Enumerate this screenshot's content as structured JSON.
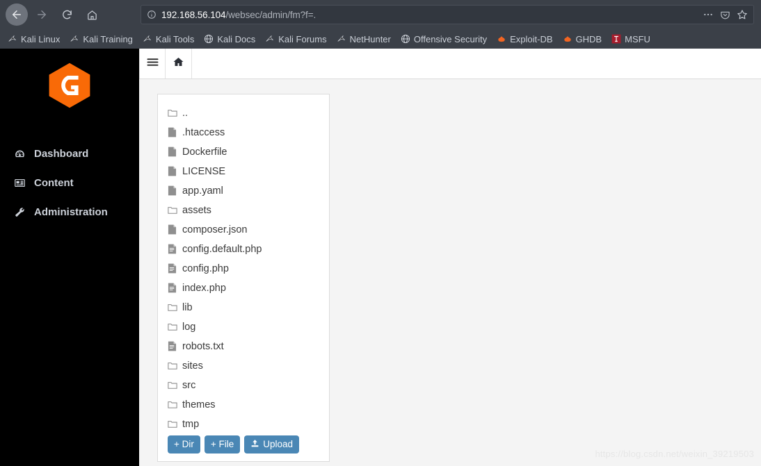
{
  "browser": {
    "nav": {
      "back_label": "Back",
      "forward_label": "Forward",
      "reload_label": "Reload",
      "home_label": "Home"
    },
    "url": {
      "host": "192.168.56.104",
      "path": "/websec/admin/fm?f=.",
      "full": "192.168.56.104/websec/admin/fm?f=."
    },
    "url_actions": [
      {
        "name": "page-actions-icon",
        "label": "•••"
      },
      {
        "name": "pocket-icon",
        "label": "Pocket"
      },
      {
        "name": "bookmark-star-icon",
        "label": "Bookmark"
      }
    ],
    "bookmarks": [
      {
        "label": "Kali Linux",
        "icon": "kali-dragon-icon"
      },
      {
        "label": "Kali Training",
        "icon": "kali-dragon-icon"
      },
      {
        "label": "Kali Tools",
        "icon": "kali-dragon-icon"
      },
      {
        "label": "Kali Docs",
        "icon": "globe-icon"
      },
      {
        "label": "Kali Forums",
        "icon": "kali-dragon-icon"
      },
      {
        "label": "NetHunter",
        "icon": "kali-dragon-icon"
      },
      {
        "label": "Offensive Security",
        "icon": "globe-icon"
      },
      {
        "label": "Exploit-DB",
        "icon": "flame-icon"
      },
      {
        "label": "GHDB",
        "icon": "flame-icon"
      },
      {
        "label": "MSFU",
        "icon": "msfu-icon"
      }
    ]
  },
  "sidebar": {
    "logo_label": "G",
    "items": [
      {
        "label": "Dashboard",
        "icon": "tachometer-icon"
      },
      {
        "label": "Content",
        "icon": "newspaper-icon"
      },
      {
        "label": "Administration",
        "icon": "wrench-icon"
      }
    ]
  },
  "topbar": {
    "menu_label": "Toggle menu",
    "home_label": "Home"
  },
  "file_manager": {
    "entries": [
      {
        "name": "..",
        "type": "dir"
      },
      {
        "name": ".htaccess",
        "type": "file"
      },
      {
        "name": "Dockerfile",
        "type": "file"
      },
      {
        "name": "LICENSE",
        "type": "file"
      },
      {
        "name": "app.yaml",
        "type": "file"
      },
      {
        "name": "assets",
        "type": "dir"
      },
      {
        "name": "composer.json",
        "type": "file"
      },
      {
        "name": "config.default.php",
        "type": "text"
      },
      {
        "name": "config.php",
        "type": "text"
      },
      {
        "name": "index.php",
        "type": "text"
      },
      {
        "name": "lib",
        "type": "dir"
      },
      {
        "name": "log",
        "type": "dir"
      },
      {
        "name": "robots.txt",
        "type": "text"
      },
      {
        "name": "sites",
        "type": "dir"
      },
      {
        "name": "src",
        "type": "dir"
      },
      {
        "name": "themes",
        "type": "dir"
      },
      {
        "name": "tmp",
        "type": "dir"
      }
    ],
    "buttons": {
      "new_dir": "+ Dir",
      "new_file": "+ File",
      "upload": "Upload"
    }
  },
  "watermark": "https://blog.csdn.net/weixin_39219503",
  "colors": {
    "chrome_bg": "#3b4048",
    "sidebar_bg": "#000000",
    "content_bg": "#f4f4f4",
    "accent_button": "#4a87b5",
    "logo_orange": "#f96a07"
  }
}
